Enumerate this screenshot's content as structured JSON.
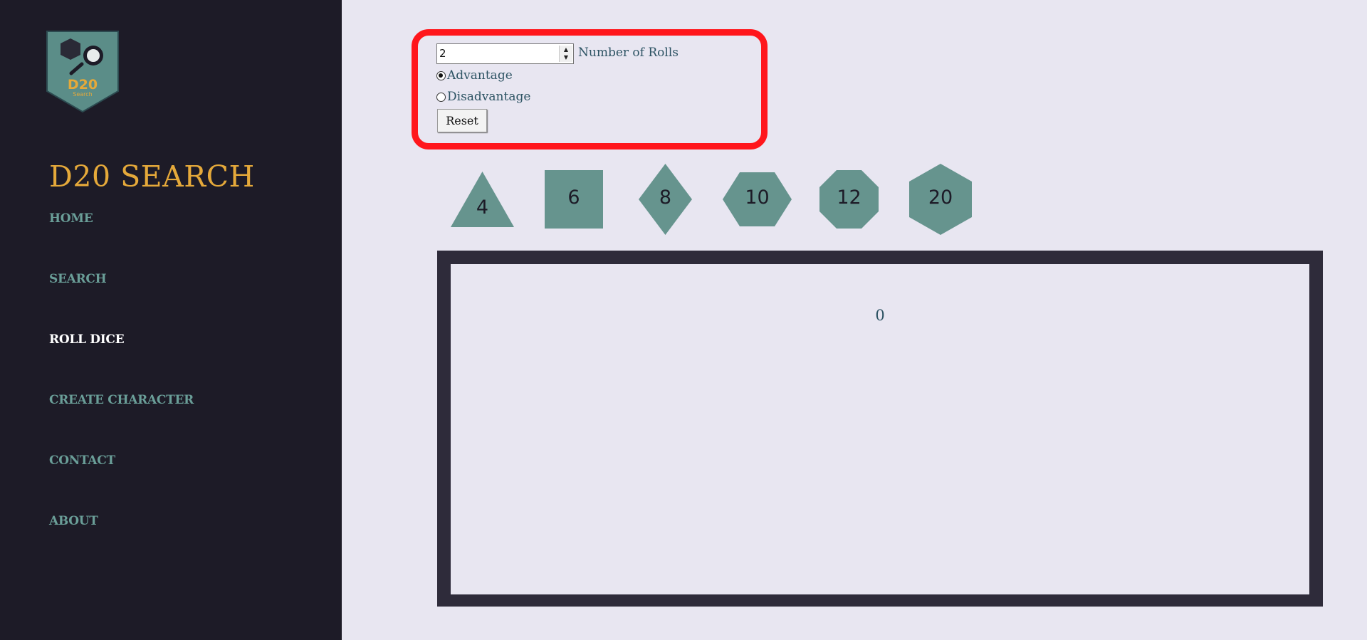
{
  "brand": {
    "logo_text": "D20",
    "logo_subtext": "Search",
    "title": "D20 SEARCH"
  },
  "nav": {
    "items": [
      {
        "label": "HOME",
        "active": false
      },
      {
        "label": "SEARCH",
        "active": false
      },
      {
        "label": "ROLL DICE",
        "active": true
      },
      {
        "label": "CREATE CHARACTER",
        "active": false
      },
      {
        "label": "CONTACT",
        "active": false
      },
      {
        "label": "ABOUT",
        "active": false
      }
    ]
  },
  "controls": {
    "rolls_value": "2",
    "rolls_label": "Number of Rolls",
    "options": [
      {
        "label": "Advantage",
        "checked": true
      },
      {
        "label": "Disadvantage",
        "checked": false
      }
    ],
    "reset_label": "Reset"
  },
  "dice": [
    {
      "sides": "4",
      "shape": "triangle"
    },
    {
      "sides": "6",
      "shape": "square"
    },
    {
      "sides": "8",
      "shape": "diamond"
    },
    {
      "sides": "10",
      "shape": "hexagon"
    },
    {
      "sides": "12",
      "shape": "octagon"
    },
    {
      "sides": "20",
      "shape": "tall-hexagon"
    }
  ],
  "result": {
    "value": "0"
  },
  "colors": {
    "sidebar_bg": "#1d1b27",
    "page_bg": "#e8e6f1",
    "brand_gold": "#e5a93a",
    "nav_teal": "#6a9e98",
    "die_fill": "#66948e",
    "highlight_red": "#ff161c",
    "result_frame": "#2e2b3a"
  }
}
